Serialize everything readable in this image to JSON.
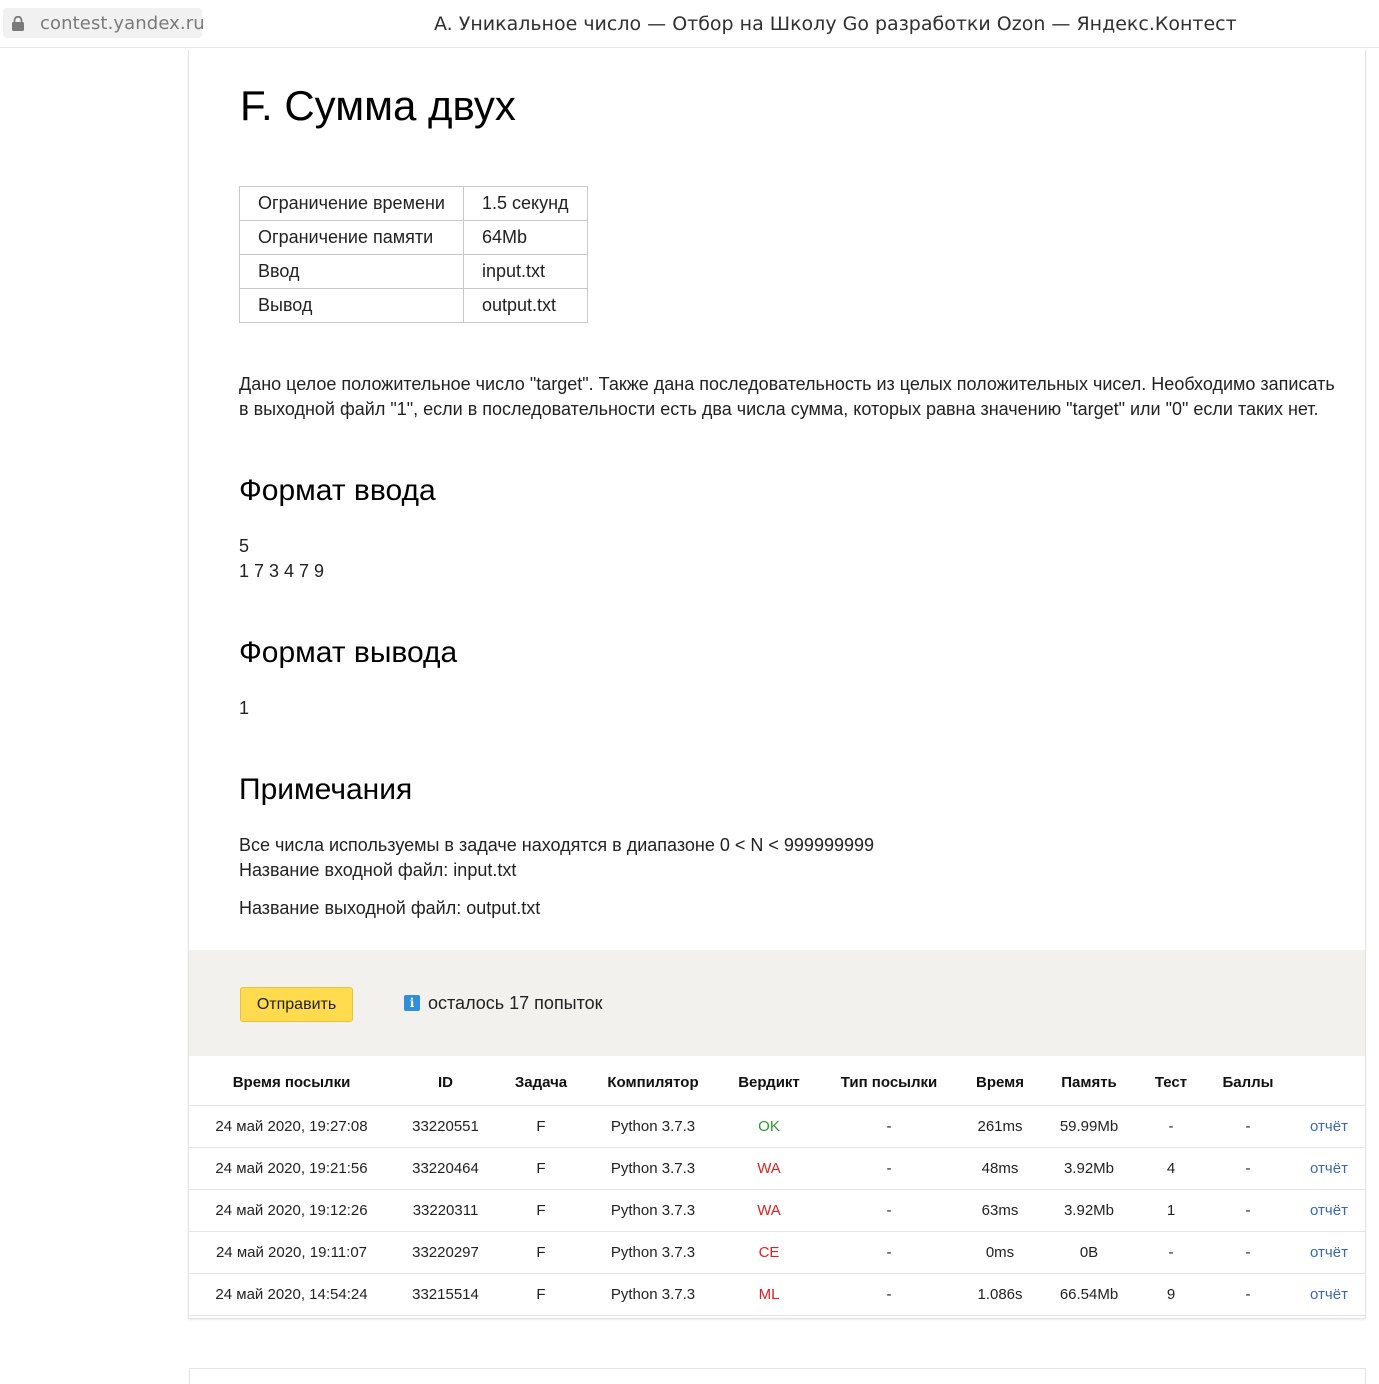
{
  "browser": {
    "url": "contest.yandex.ru",
    "tab_title": "A. Уникальное число — Отбор на Школу Go разработки Ozon — Яндекс.Контест"
  },
  "problem": {
    "title": "F. Сумма двух",
    "limits": [
      {
        "key": "Ограничение времени",
        "value": "1.5 секунд"
      },
      {
        "key": "Ограничение памяти",
        "value": "64Mb"
      },
      {
        "key": "Ввод",
        "value": "input.txt"
      },
      {
        "key": "Вывод",
        "value": "output.txt"
      }
    ],
    "statement_line1": "Дано целое положительное число \"target\". Также дана последовательность из целых положительных чисел. Необходимо записать",
    "statement_line2": "в выходной файл \"1\", если в последовательности есть два числа сумма, которых равна значению \"target\" или \"0\" если таких нет.",
    "input_heading": "Формат ввода",
    "input_line1": "5",
    "input_line2": "1 7 3 4 7 9",
    "output_heading": "Формат вывода",
    "output_line1": "1",
    "notes_heading": "Примечания",
    "notes_line1": "Все числа используемы в задаче находятся в диапазоне 0 < N < 999999999",
    "notes_line2": "Название входной файл: input.txt",
    "notes_line3": "Название выходной файл: output.txt"
  },
  "submit": {
    "button_label": "Отправить",
    "info_icon": "i",
    "attempts_text": "осталось 17 попыток"
  },
  "submissions": {
    "headers": {
      "time": "Время посылки",
      "id": "ID",
      "task": "Задача",
      "compiler": "Компилятор",
      "verdict": "Вердикт",
      "type": "Тип посылки",
      "duration": "Время",
      "memory": "Память",
      "test": "Тест",
      "score": "Баллы"
    },
    "rows": [
      {
        "time": "24 май 2020, 19:27:08",
        "id": "33220551",
        "task": "F",
        "compiler": "Python 3.7.3",
        "verdict": "OK",
        "type": "-",
        "duration": "261ms",
        "memory": "59.99Mb",
        "test": "-",
        "score": "-",
        "report": "отчёт"
      },
      {
        "time": "24 май 2020, 19:21:56",
        "id": "33220464",
        "task": "F",
        "compiler": "Python 3.7.3",
        "verdict": "WA",
        "type": "-",
        "duration": "48ms",
        "memory": "3.92Mb",
        "test": "4",
        "score": "-",
        "report": "отчёт"
      },
      {
        "time": "24 май 2020, 19:12:26",
        "id": "33220311",
        "task": "F",
        "compiler": "Python 3.7.3",
        "verdict": "WA",
        "type": "-",
        "duration": "63ms",
        "memory": "3.92Mb",
        "test": "1",
        "score": "-",
        "report": "отчёт"
      },
      {
        "time": "24 май 2020, 19:11:07",
        "id": "33220297",
        "task": "F",
        "compiler": "Python 3.7.3",
        "verdict": "CE",
        "type": "-",
        "duration": "0ms",
        "memory": "0B",
        "test": "-",
        "score": "-",
        "report": "отчёт"
      },
      {
        "time": "24 май 2020, 14:54:24",
        "id": "33215514",
        "task": "F",
        "compiler": "Python 3.7.3",
        "verdict": "ML",
        "type": "-",
        "duration": "1.086s",
        "memory": "66.54Mb",
        "test": "9",
        "score": "-",
        "report": "отчёт"
      }
    ]
  },
  "colors": {
    "verdict_ok": "#2e9a2e",
    "verdict_fail": "#e02020",
    "link": "#3a67b5",
    "button": "#ffdb4d"
  }
}
